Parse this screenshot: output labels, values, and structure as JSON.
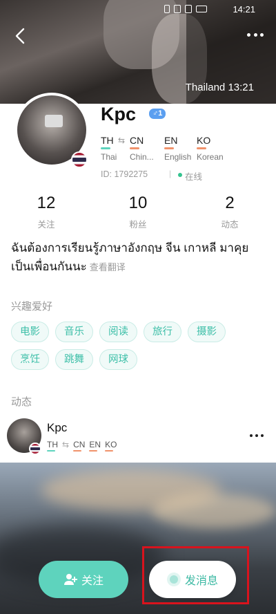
{
  "status_bar": {
    "time": "14:21"
  },
  "header": {
    "location": "Thailand",
    "local_time": "13:21"
  },
  "profile": {
    "name": "Kpc",
    "gender_badge": "♂1",
    "languages": [
      {
        "code": "TH",
        "full": "Thai",
        "color": "#5ed3bd"
      },
      {
        "code": "CN",
        "full": "Chin...",
        "color": "#f0926b"
      },
      {
        "code": "EN",
        "full": "English",
        "color": "#f0926b"
      },
      {
        "code": "KO",
        "full": "Korean",
        "color": "#f0926b"
      }
    ],
    "id_label": "ID:",
    "id": "1792275",
    "separator": "|",
    "online_status": "在线"
  },
  "stats": [
    {
      "value": "12",
      "label": "关注"
    },
    {
      "value": "10",
      "label": "粉丝"
    },
    {
      "value": "2",
      "label": "动态"
    }
  ],
  "bio": {
    "text": "ฉันต้องการเรียนรู้ภาษาอังกฤษ จีน เกาหลี มาคุยเป็นเพื่อนกันนะ",
    "translate_link": "查看翻译"
  },
  "interests": {
    "title": "兴趣爱好",
    "tags": [
      "电影",
      "音乐",
      "阅读",
      "旅行",
      "摄影",
      "烹饪",
      "跳舞",
      "网球"
    ]
  },
  "moments": {
    "title": "动态",
    "post": {
      "author": "Kpc",
      "langs": [
        {
          "code": "TH",
          "color": "#5ed3bd"
        },
        {
          "code": "CN",
          "color": "#f0926b"
        },
        {
          "code": "EN",
          "color": "#f0926b"
        },
        {
          "code": "KO",
          "color": "#f0926b"
        }
      ]
    }
  },
  "actions": {
    "follow_label": "关注",
    "message_label": "发消息"
  },
  "colors": {
    "accent": "#5ed3bd",
    "accent_text": "#3cb9a3",
    "highlight": "#d9131d",
    "online": "#34c38f"
  }
}
